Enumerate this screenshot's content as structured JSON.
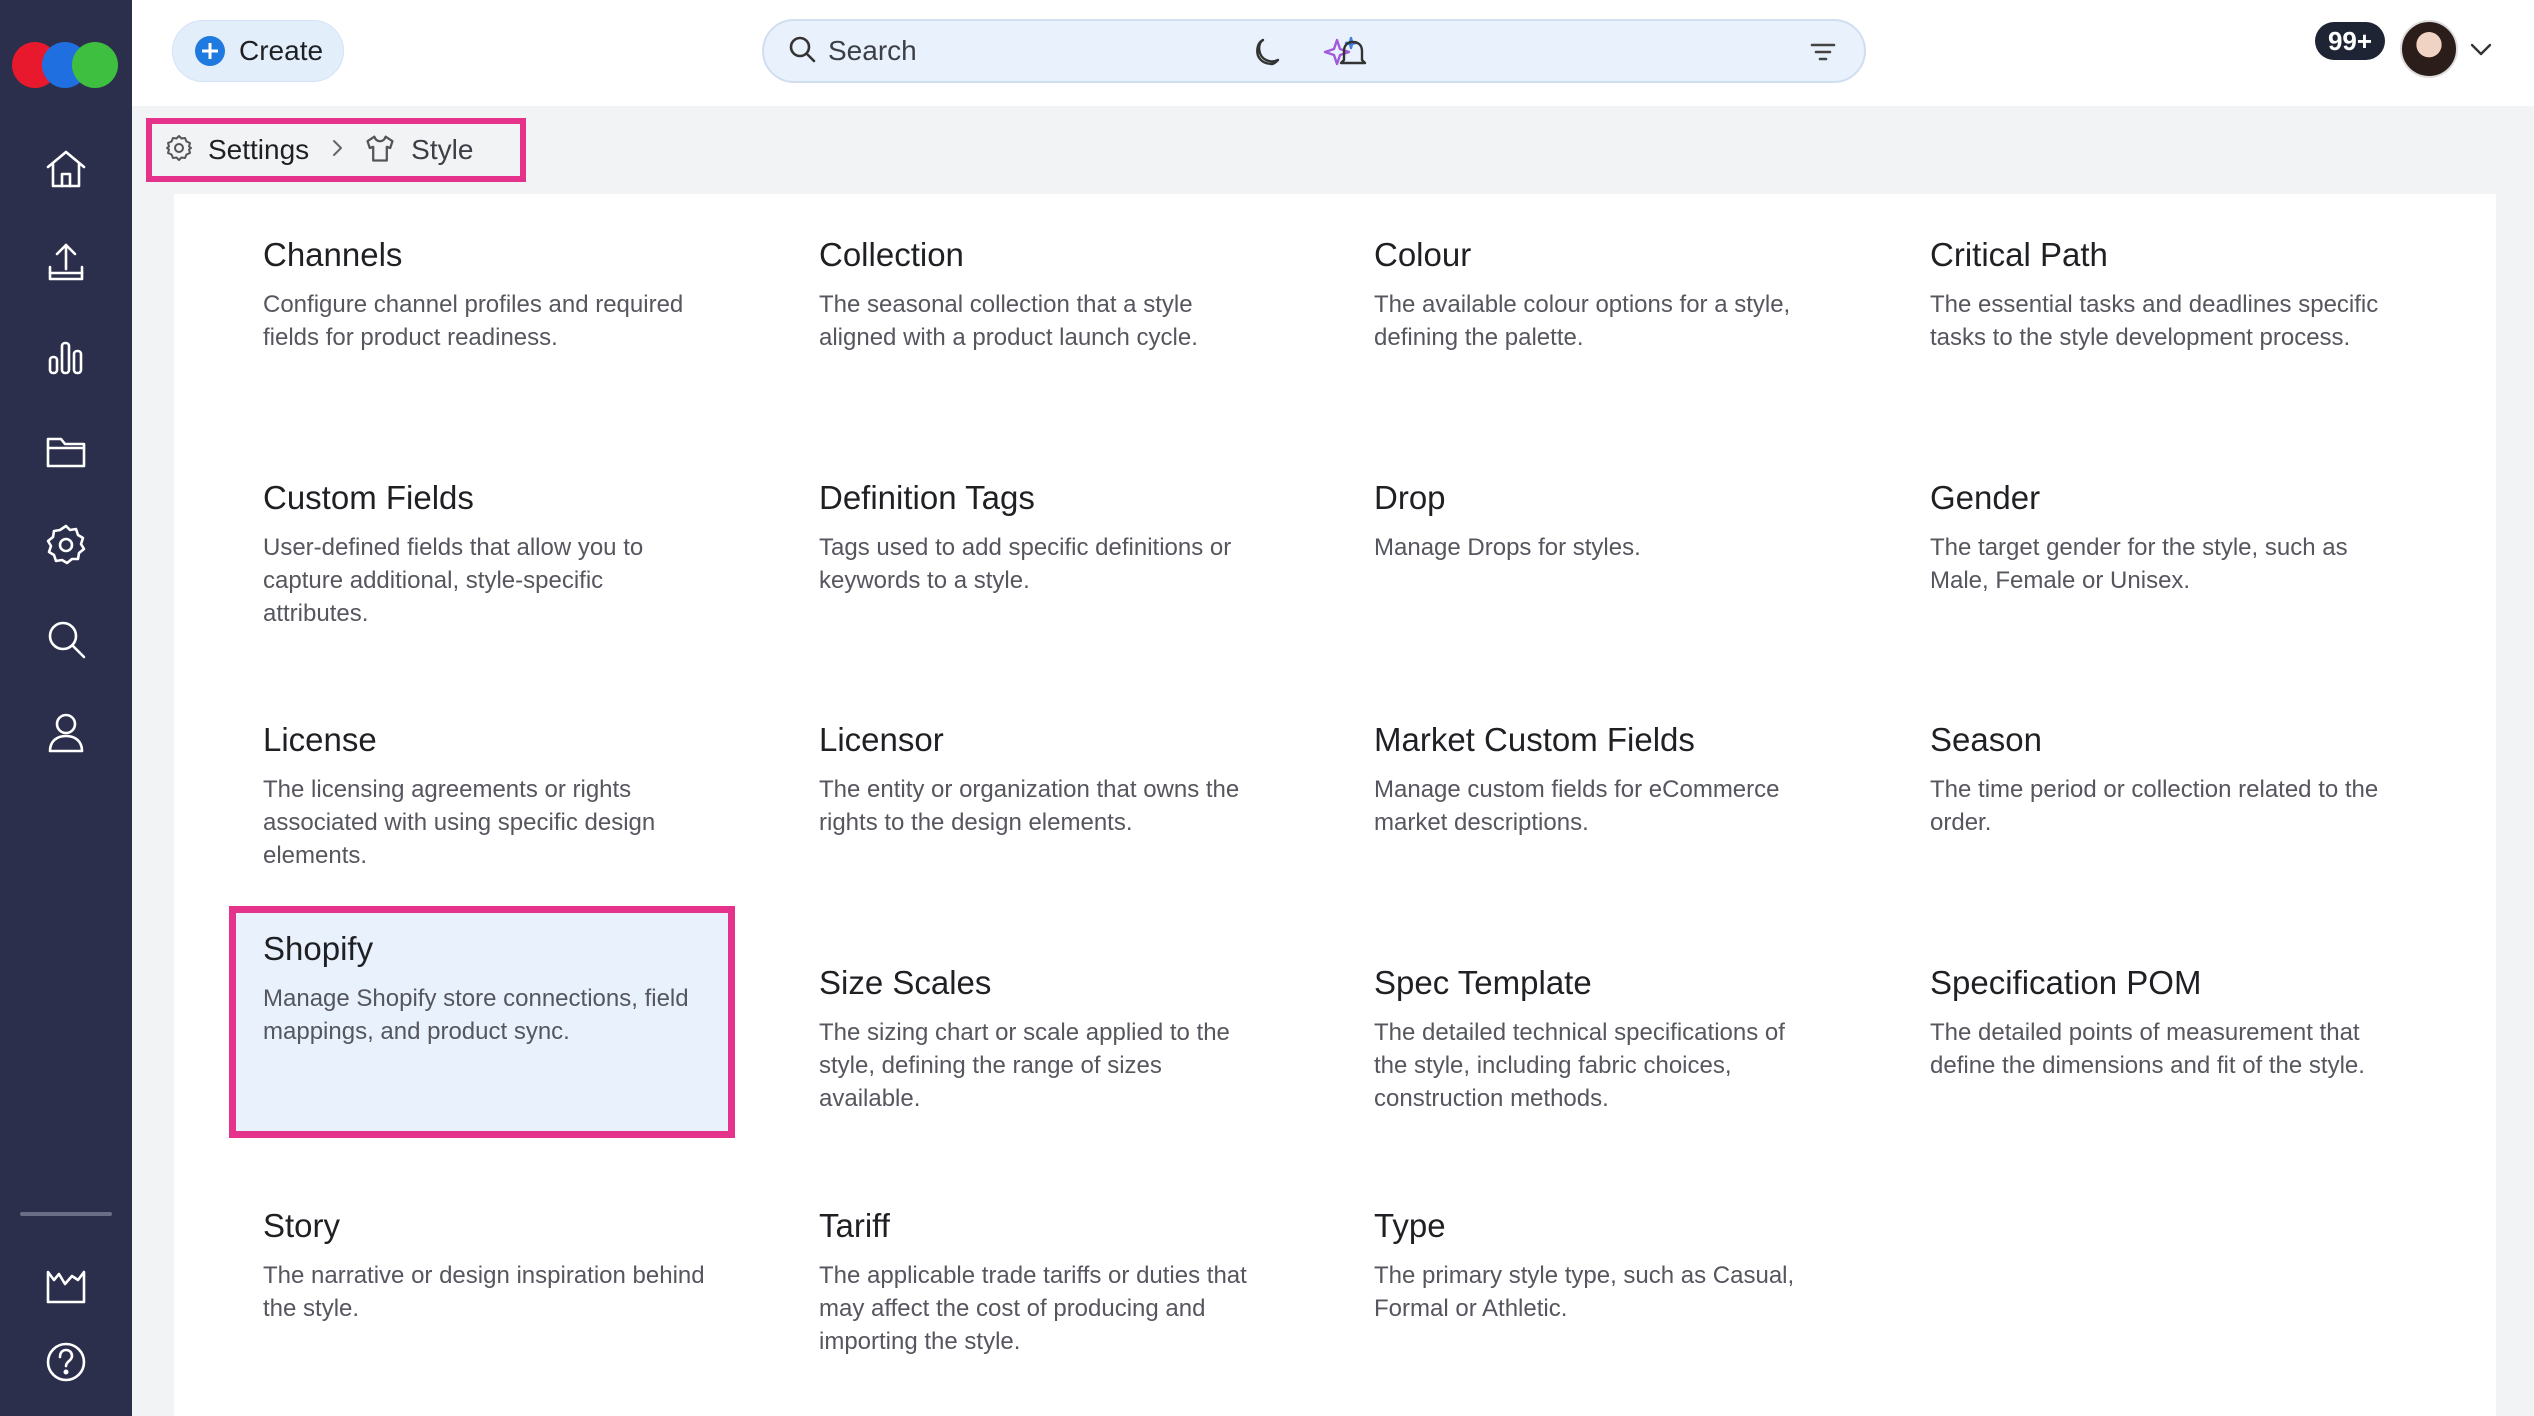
{
  "header": {
    "create_label": "Create",
    "search_placeholder": "Search",
    "notification_count": "99+"
  },
  "colors": {
    "sidebar": "#2b2f4b",
    "accent": "#1f7ae0",
    "highlight_border": "#e5338b",
    "logo": [
      "#e8192c",
      "#1f6fe0",
      "#3fbf3f"
    ]
  },
  "sidebar": {
    "items": [
      {
        "icon": "home-icon"
      },
      {
        "icon": "upload-icon"
      },
      {
        "icon": "bar-chart-icon"
      },
      {
        "icon": "folder-icon"
      },
      {
        "icon": "settings-icon"
      },
      {
        "icon": "search-icon"
      },
      {
        "icon": "user-icon"
      }
    ],
    "bottom_items": [
      {
        "icon": "factory-icon"
      },
      {
        "icon": "help-icon"
      }
    ]
  },
  "breadcrumb": {
    "root": "Settings",
    "current": "Style"
  },
  "cards": [
    {
      "title": "Channels",
      "description": "Configure channel profiles and required fields for product readiness."
    },
    {
      "title": "Collection",
      "description": "The seasonal collection that a style aligned with a product launch cycle."
    },
    {
      "title": "Colour",
      "description": "The available colour options for a style, defining the palette."
    },
    {
      "title": "Critical Path",
      "description": "The essential tasks and deadlines specific tasks to the style development process."
    },
    {
      "title": "Custom Fields",
      "description": "User-defined fields that allow you to capture additional, style-specific attributes."
    },
    {
      "title": "Definition Tags",
      "description": "Tags used to add specific definitions or keywords to a style."
    },
    {
      "title": "Drop",
      "description": "Manage Drops for styles."
    },
    {
      "title": "Gender",
      "description": "The target gender for the style, such as Male, Female or Unisex."
    },
    {
      "title": "License",
      "description": "The licensing agreements or rights associated with using specific design elements."
    },
    {
      "title": "Licensor",
      "description": "The entity or organization that owns the rights to the design elements."
    },
    {
      "title": "Market Custom Fields",
      "description": "Manage custom fields for eCommerce market descriptions."
    },
    {
      "title": "Season",
      "description": "The time period or collection related to the order."
    },
    {
      "title": "Shopify",
      "description": "Manage Shopify store connections, field mappings, and product sync.",
      "highlighted": true
    },
    {
      "title": "Size Scales",
      "description": "The sizing chart or scale applied to the style, defining the range of sizes available."
    },
    {
      "title": "Spec Template",
      "description": "The detailed technical specifications of the style, including fabric choices, construction methods."
    },
    {
      "title": "Specification POM",
      "description": "The detailed points of measurement that define the dimensions and fit of the style."
    },
    {
      "title": "Story",
      "description": "The narrative or design inspiration behind the style."
    },
    {
      "title": "Tariff",
      "description": "The applicable trade tariffs or duties that may affect the cost of producing and importing the style."
    },
    {
      "title": "Type",
      "description": "The primary style type, such as Casual, Formal or Athletic."
    }
  ]
}
